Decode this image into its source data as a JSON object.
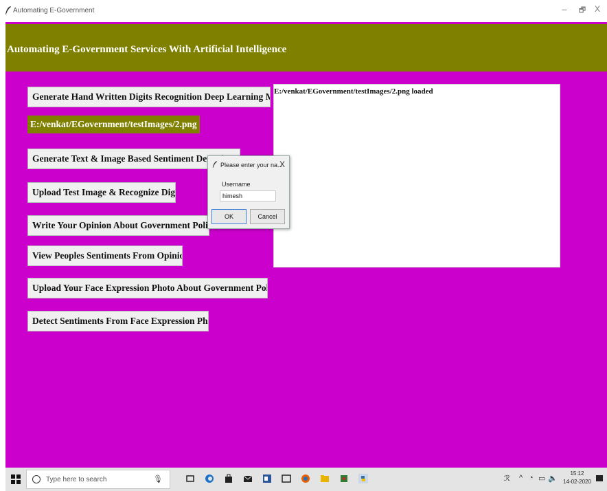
{
  "window": {
    "title": "Automating E-Government",
    "min": "–",
    "max": "🗗",
    "close": "X"
  },
  "header": {
    "title": "Automating E-Government Services With Artificial Intelligence"
  },
  "buttons": {
    "gen_digits": "Generate Hand Written Digits Recognition Deep Learning Model",
    "gen_text_image": "Generate Text & Image Based Sentiment Detection Deep Learning Model",
    "upload_digit": "Upload Test Image & Recognize Digit",
    "write_opinion": "Write Your Opinion About Government Policies",
    "view_sentiments": "View Peoples Sentiments From Opinions",
    "upload_face": "Upload Your Face Expression Photo About Government Policies",
    "detect_face": "Detect Sentiments From Face Expression Photo"
  },
  "path_label": "E:/venkat/EGovernment/testImages/2.png",
  "output": {
    "text": "E:/venkat/EGovernment/testImages/2.png loaded"
  },
  "dialog": {
    "title": "Please enter your na...",
    "close": "X",
    "label": "Username",
    "value": "himesh",
    "ok": "OK",
    "cancel": "Cancel"
  },
  "taskbar": {
    "search_placeholder": "Type here to search",
    "time": "15:12",
    "date": "14-02-2020",
    "icons": [
      "windows-icon",
      "task-view-icon",
      "edge-icon",
      "store-icon",
      "mail-icon",
      "word-icon",
      "terminal-icon",
      "firefox-icon",
      "file-explorer-icon",
      "app-icon",
      "python-icon"
    ]
  },
  "colors": {
    "background": "#cc00cc",
    "header": "#808000",
    "button": "#f0f0f0"
  }
}
